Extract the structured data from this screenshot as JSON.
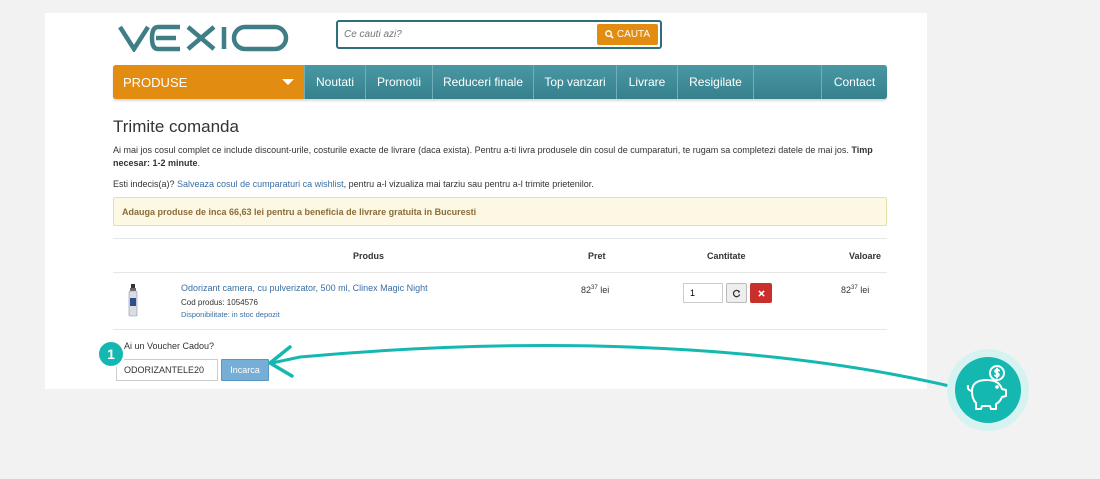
{
  "brand": {
    "name": "VEXIO",
    "accent": "#e38c12",
    "nav_color": "#3b8693",
    "callout_color": "#14b8b0"
  },
  "search": {
    "placeholder": "Ce cauti azi?",
    "button_label": "CAUTA",
    "icon": "search-icon"
  },
  "nav": {
    "products_label": "PRODUSE",
    "items": [
      "Noutati",
      "Promotii",
      "Reduceri finale",
      "Top vanzari",
      "Livrare",
      "Resigilate",
      "",
      "Contact"
    ]
  },
  "checkout": {
    "title": "Trimite comanda",
    "intro": "Ai mai jos cosul complet ce include discount-urile, costurile exacte de livrare (daca exista). Pentru a-ti livra produsele din cosul de cumparaturi, te rugam sa completezi datele de mai jos.",
    "time_label": "Timp necesar: 1-2 minute",
    "undecided_prefix": "Esti indecis(a)? ",
    "wishlist_link": "Salveaza cosul de cumparaturi ca wishlist",
    "undecided_suffix": ", pentru a-l vizualiza mai tarziu sau pentru a-l trimite prietenilor.",
    "notice": "Adauga produse de inca 66,63 lei pentru a beneficia de livrare gratuita in Bucuresti"
  },
  "table": {
    "headers": {
      "product": "Produs",
      "price": "Pret",
      "quantity": "Cantitate",
      "value": "Valoare"
    },
    "rows": [
      {
        "name": "Odorizant camera, cu pulverizator, 500 ml, Clinex Magic Night",
        "code": "Cod produs: 1054576",
        "availability": "Disponibilitate: in stoc depozit",
        "price_int": "82",
        "price_dec": "37",
        "currency": "lei",
        "quantity": "1",
        "value_int": "82",
        "value_dec": "37"
      }
    ]
  },
  "voucher": {
    "question": "Ai un Voucher Cadou?",
    "code": "ODORIZANTELE20",
    "button_label": "Incarca"
  },
  "annotation": {
    "step": "1",
    "icon": "piggy-bank-icon"
  }
}
